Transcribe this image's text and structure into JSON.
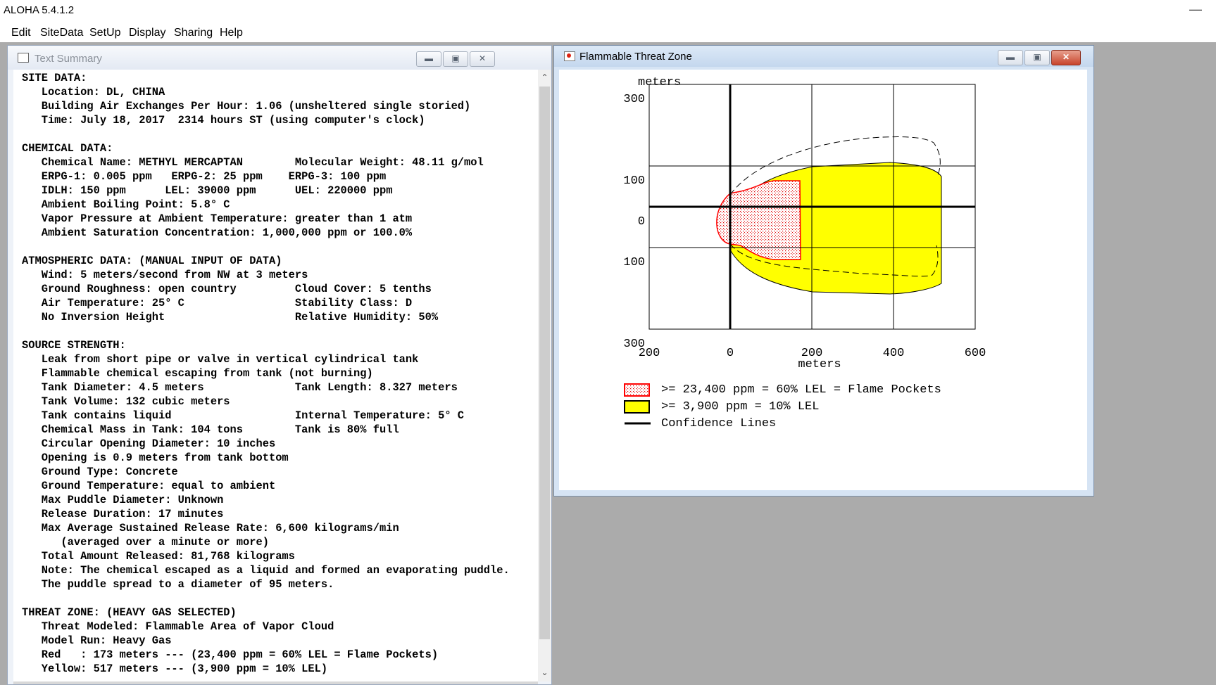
{
  "app": {
    "title": "ALOHA 5.4.1.2",
    "minimize_glyph": "—"
  },
  "menu": [
    "Edit",
    "SiteData",
    "SetUp",
    "Display",
    "Sharing",
    "Help"
  ],
  "text_summary": {
    "title": "Text Summary",
    "lines": [
      "SITE DATA:",
      "   Location: DL, CHINA",
      "   Building Air Exchanges Per Hour: 1.06 (unsheltered single storied)",
      "   Time: July 18, 2017  2314 hours ST (using computer's clock)",
      "",
      "CHEMICAL DATA:",
      "   Chemical Name: METHYL MERCAPTAN        Molecular Weight: 48.11 g/mol",
      "   ERPG-1: 0.005 ppm   ERPG-2: 25 ppm    ERPG-3: 100 ppm",
      "   IDLH: 150 ppm      LEL: 39000 ppm      UEL: 220000 ppm",
      "   Ambient Boiling Point: 5.8° C",
      "   Vapor Pressure at Ambient Temperature: greater than 1 atm",
      "   Ambient Saturation Concentration: 1,000,000 ppm or 100.0%",
      "",
      "ATMOSPHERIC DATA: (MANUAL INPUT OF DATA)",
      "   Wind: 5 meters/second from NW at 3 meters",
      "   Ground Roughness: open country         Cloud Cover: 5 tenths",
      "   Air Temperature: 25° C                 Stability Class: D",
      "   No Inversion Height                    Relative Humidity: 50%",
      "",
      "SOURCE STRENGTH:",
      "   Leak from short pipe or valve in vertical cylindrical tank",
      "   Flammable chemical escaping from tank (not burning)",
      "   Tank Diameter: 4.5 meters              Tank Length: 8.327 meters",
      "   Tank Volume: 132 cubic meters",
      "   Tank contains liquid                   Internal Temperature: 5° C",
      "   Chemical Mass in Tank: 104 tons        Tank is 80% full",
      "   Circular Opening Diameter: 10 inches",
      "   Opening is 0.9 meters from tank bottom",
      "   Ground Type: Concrete",
      "   Ground Temperature: equal to ambient",
      "   Max Puddle Diameter: Unknown",
      "   Release Duration: 17 minutes",
      "   Max Average Sustained Release Rate: 6,600 kilograms/min",
      "      (averaged over a minute or more)",
      "   Total Amount Released: 81,768 kilograms",
      "   Note: The chemical escaped as a liquid and formed an evaporating puddle.",
      "   The puddle spread to a diameter of 95 meters.",
      "",
      "THREAT ZONE: (HEAVY GAS SELECTED)",
      "   Threat Modeled: Flammable Area of Vapor Cloud",
      "   Model Run: Heavy Gas",
      "   Red   : 173 meters --- (23,400 ppm = 60% LEL = Flame Pockets)",
      "   Yellow: 517 meters --- (3,900 ppm = 10% LEL)"
    ]
  },
  "threat_window": {
    "title": "Flammable Threat Zone",
    "plot": {
      "y_unit_label": "meters",
      "x_unit_label": "meters",
      "y_ticks": [
        "300",
        "100",
        "0",
        "100",
        "300"
      ],
      "x_ticks": [
        "200",
        "0",
        "200",
        "400",
        "600"
      ],
      "red_zone_extent_m": 173,
      "yellow_zone_extent_m": 517
    },
    "legend": [
      {
        "label": ">= 23,400 ppm = 60% LEL = Flame Pockets",
        "swatch": "red-dotted"
      },
      {
        "label": ">= 3,900 ppm = 10% LEL",
        "swatch": "yellow"
      },
      {
        "label": "Confidence Lines",
        "swatch": "line"
      }
    ]
  },
  "colors": {
    "yellow_zone": "#ffff00",
    "red_zone": "#ff0000",
    "mdi_background": "#ababab"
  }
}
